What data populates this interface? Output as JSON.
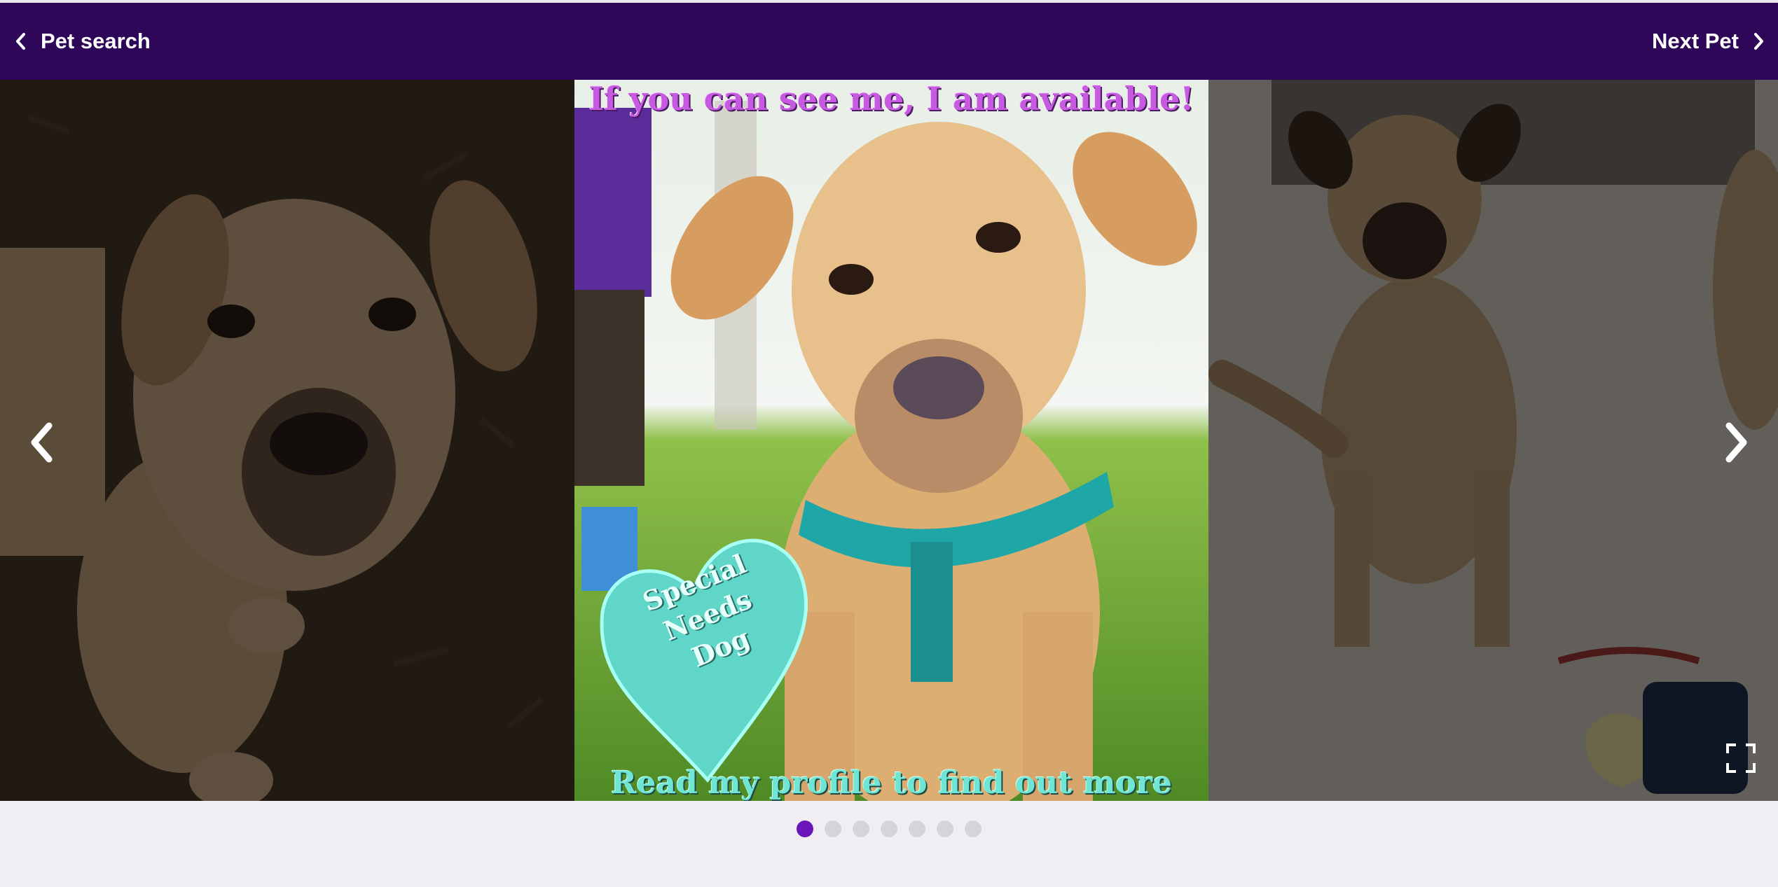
{
  "header": {
    "back_label": "Pet search",
    "next_label": "Next Pet",
    "background": "#2e0758"
  },
  "carousel": {
    "current_slide": {
      "top_banner": "If you can see me, I am available!",
      "heart_badge_lines": [
        "Special",
        "Needs",
        "Dog"
      ],
      "bottom_banner": "Read my profile to find out more"
    },
    "prev_arrow_icon": "chevron-left-icon",
    "next_arrow_icon": "chevron-right-icon",
    "fullscreen_icon": "fullscreen-icon",
    "dots_total": 7,
    "active_dot": 1,
    "accent_color": "#6a16b8"
  }
}
